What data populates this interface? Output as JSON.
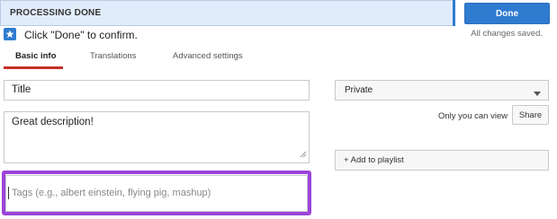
{
  "status": {
    "label": "PROCESSING DONE",
    "done_button": "Done",
    "confirm_message": "Click \"Done\" to confirm.",
    "saved_message": "All changes saved.",
    "accent_color": "#2f7bd0"
  },
  "tabs": [
    {
      "label": "Basic info",
      "active": true
    },
    {
      "label": "Translations",
      "active": false
    },
    {
      "label": "Advanced settings",
      "active": false
    }
  ],
  "form": {
    "title_value": "Title",
    "description_value": "Great description!",
    "tags_placeholder": "Tags (e.g., albert einstein, flying pig, mashup)",
    "tags_highlight_color": "#9b44d9"
  },
  "sidebar": {
    "privacy_selected": "Private",
    "visibility_note": "Only you can view",
    "share_button": "Share",
    "playlist_button": "+ Add to playlist"
  },
  "icons": {
    "star": "star-icon",
    "dropdown": "chevron-down-icon",
    "resize": "resize-grip-icon"
  }
}
